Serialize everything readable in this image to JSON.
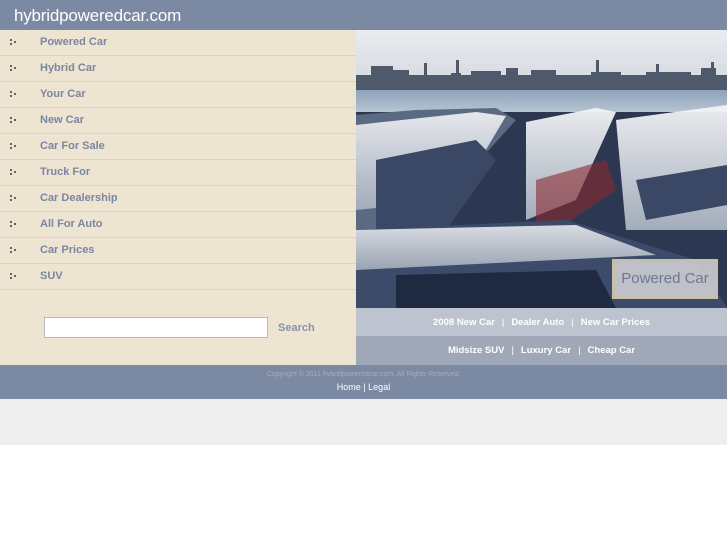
{
  "header": {
    "title": "hybridpoweredcar.com"
  },
  "sidebar": {
    "items": [
      {
        "label": "Powered Car",
        "icon": "bullet-dots-icon"
      },
      {
        "label": "Hybrid Car",
        "icon": "bullet-dots-icon"
      },
      {
        "label": "Your Car",
        "icon": "bullet-dots-icon"
      },
      {
        "label": "New Car",
        "icon": "bullet-dots-icon"
      },
      {
        "label": "Car For Sale",
        "icon": "bullet-dots-icon"
      },
      {
        "label": "Truck For",
        "icon": "bullet-dots-icon"
      },
      {
        "label": "Car Dealership",
        "icon": "bullet-dots-icon"
      },
      {
        "label": "All For Auto",
        "icon": "bullet-dots-icon"
      },
      {
        "label": "Car Prices",
        "icon": "bullet-dots-icon"
      },
      {
        "label": "SUV",
        "icon": "bullet-dots-icon"
      }
    ],
    "search": {
      "value": "",
      "placeholder": "",
      "button_label": "Search"
    }
  },
  "hero": {
    "image_description": "Rows of parked new cars at a port with industrial skyline",
    "badge_label": "Powered Car"
  },
  "links": {
    "row1": [
      "2008 New Car",
      "Dealer Auto",
      "New Car Prices"
    ],
    "row2": [
      "Midsize SUV",
      "Luxury Car",
      "Cheap Car"
    ],
    "separator": "|"
  },
  "footer": {
    "copyright": "Copyright © 2011 hybridpoweredcar.com. All Rights Reserved.",
    "links": [
      "Home",
      "Legal"
    ],
    "separator": "|"
  },
  "colors": {
    "header_bg": "#7c89a2",
    "sidebar_bg": "#ede4d2",
    "nav_text": "#7b86a0",
    "links_row1_bg": "#bec4cf",
    "links_row2_bg": "#a0a8b8"
  }
}
